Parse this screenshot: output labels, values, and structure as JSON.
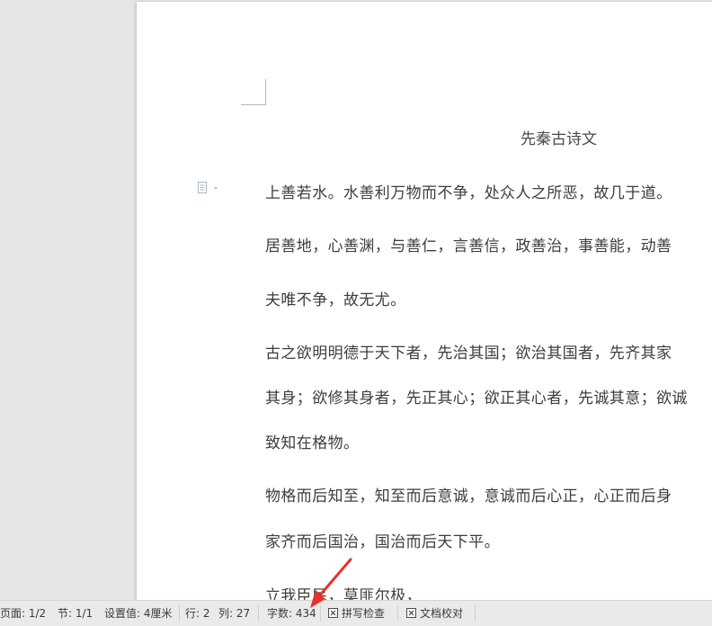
{
  "document": {
    "title": "先秦古诗文",
    "lines": [
      "上善若水。水善利万物而不争，处众人之所恶，故几于道。",
      "居善地，心善渊，与善仁，言善信，政善治，事善能，动善",
      "夫唯不争，故无尤。",
      "古之欲明明德于天下者，先治其国；欲治其国者，先齐其家",
      "其身；欲修其身者，先正其心；欲正其心者，先诚其意；欲诚",
      "致知在格物。",
      "物格而后知至，知至而后意诚，意诚而后心正，心正而后身",
      "家齐而后国治，国治而后天下平。",
      "立我臣民，莫匪尔极，"
    ]
  },
  "status_bar": {
    "page": "页面: 1/2",
    "section": "节: 1/1",
    "setting": "设置值: 4厘米",
    "row": "行: 2",
    "column": "列: 27",
    "word_count": "字数: 434",
    "spell_check": "拼写检查",
    "doc_proof": "文档校对"
  },
  "colors": {
    "workspace": "#e6e6e6",
    "page": "#ffffff",
    "text": "#3d3d3d",
    "arrow": "#e8322c"
  }
}
